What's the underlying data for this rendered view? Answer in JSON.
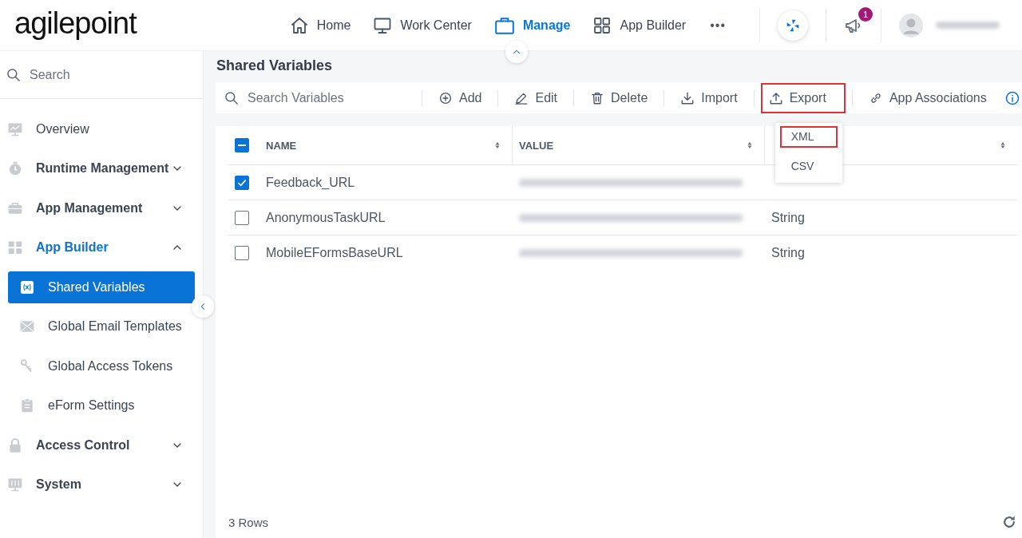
{
  "header": {
    "logo": "agilepoint",
    "nav": [
      {
        "label": "Home",
        "selected": false
      },
      {
        "label": "Work Center",
        "selected": false
      },
      {
        "label": "Manage",
        "selected": true
      },
      {
        "label": "App Builder",
        "selected": false
      }
    ],
    "more": "•••",
    "notifications": "1"
  },
  "sidebar": {
    "search": {
      "placeholder": "Search"
    },
    "items": [
      {
        "label": "Overview",
        "selected": false,
        "kind": "link"
      },
      {
        "label": "Runtime Management",
        "selected": false,
        "kind": "group",
        "expanded": false
      },
      {
        "label": "App Management",
        "selected": false,
        "kind": "group",
        "expanded": false
      },
      {
        "label": "App Builder",
        "selected": true,
        "kind": "group",
        "expanded": true,
        "children": [
          {
            "label": "Shared Variables",
            "selected": true
          },
          {
            "label": "Global Email Templates",
            "selected": false
          },
          {
            "label": "Global Access Tokens",
            "selected": false
          },
          {
            "label": "eForm Settings",
            "selected": false
          }
        ]
      },
      {
        "label": "Access Control",
        "selected": false,
        "kind": "group",
        "expanded": false
      },
      {
        "label": "System",
        "selected": false,
        "kind": "group",
        "expanded": false
      }
    ]
  },
  "page": {
    "title": "Shared Variables",
    "search": {
      "placeholder": "Search Variables"
    },
    "toolbar": [
      {
        "label": "Add",
        "highlighted": false
      },
      {
        "label": "Edit",
        "highlighted": false
      },
      {
        "label": "Delete",
        "highlighted": false
      },
      {
        "label": "Import",
        "highlighted": false
      },
      {
        "label": "Export",
        "highlighted": true
      },
      {
        "label": "App Associations",
        "highlighted": false
      }
    ],
    "export_menu": [
      {
        "label": "XML",
        "highlighted": true
      },
      {
        "label": "CSV",
        "highlighted": false
      }
    ],
    "table": {
      "all_indeterminate": true,
      "columns": [
        "NAME",
        "VALUE",
        ""
      ],
      "rows": [
        {
          "checked": true,
          "name": "Feedback_URL"
        },
        {
          "checked": false,
          "name": "AnonymousTaskURL",
          "type": "String"
        },
        {
          "checked": false,
          "name": "MobileEFormsBaseURL",
          "type": "String"
        }
      ]
    },
    "row_count": "3 Rows"
  }
}
